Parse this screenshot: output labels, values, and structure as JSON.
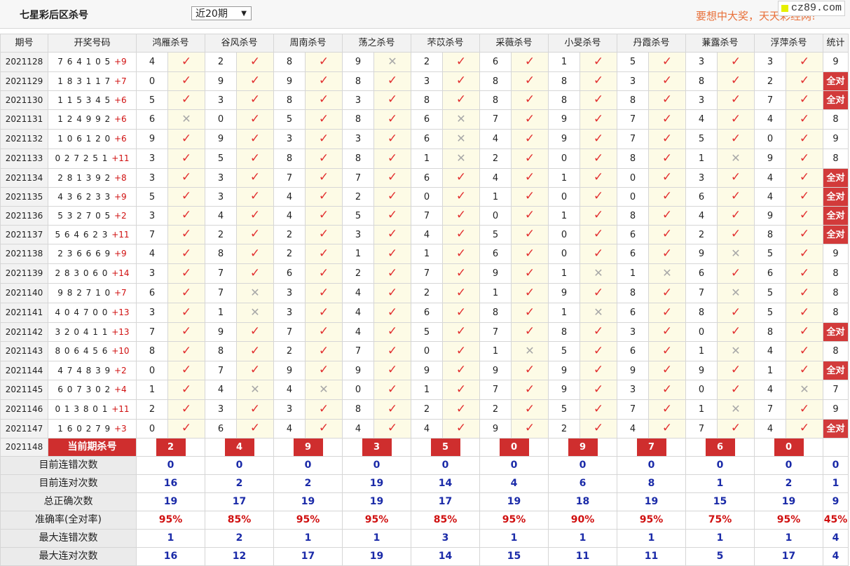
{
  "header": {
    "title": "七星彩后区杀号",
    "period_select": "近20期",
    "slogan": "要想中大奖，天天彩经网!",
    "site_badge": "cz89.com"
  },
  "columns": [
    "期号",
    "开奖号码",
    "鸿雁杀号",
    "谷风杀号",
    "周南杀号",
    "荡之杀号",
    "芣苡杀号",
    "采薇杀号",
    "小旻杀号",
    "丹霞杀号",
    "蒹露杀号",
    "浮萍杀号",
    "统计"
  ],
  "rows": [
    {
      "period": "2021128",
      "draw": "7 6 4 1 0 5",
      "bonus": "+9",
      "kills": [
        "4",
        "2",
        "8",
        "9",
        "2",
        "6",
        "1",
        "5",
        "3",
        "3"
      ],
      "marks": [
        1,
        1,
        1,
        0,
        1,
        1,
        1,
        1,
        1,
        1
      ],
      "stat": "9"
    },
    {
      "period": "2021129",
      "draw": "1 8 3 1 1 7",
      "bonus": "+7",
      "kills": [
        "0",
        "9",
        "9",
        "8",
        "3",
        "8",
        "8",
        "3",
        "8",
        "2"
      ],
      "marks": [
        1,
        1,
        1,
        1,
        1,
        1,
        1,
        1,
        1,
        1
      ],
      "stat": "全对"
    },
    {
      "period": "2021130",
      "draw": "1 1 5 3 4 5",
      "bonus": "+6",
      "kills": [
        "5",
        "3",
        "8",
        "3",
        "8",
        "8",
        "8",
        "8",
        "3",
        "7"
      ],
      "marks": [
        1,
        1,
        1,
        1,
        1,
        1,
        1,
        1,
        1,
        1
      ],
      "stat": "全对"
    },
    {
      "period": "2021131",
      "draw": "1 2 4 9 9 2",
      "bonus": "+6",
      "kills": [
        "6",
        "0",
        "5",
        "8",
        "6",
        "7",
        "9",
        "7",
        "4",
        "4"
      ],
      "marks": [
        0,
        1,
        1,
        1,
        0,
        1,
        1,
        1,
        1,
        1
      ],
      "stat": "8"
    },
    {
      "period": "2021132",
      "draw": "1 0 6 1 2 0",
      "bonus": "+6",
      "kills": [
        "9",
        "9",
        "3",
        "3",
        "6",
        "4",
        "9",
        "7",
        "5",
        "0"
      ],
      "marks": [
        1,
        1,
        1,
        1,
        0,
        1,
        1,
        1,
        1,
        1
      ],
      "stat": "9"
    },
    {
      "period": "2021133",
      "draw": "0 2 7 2 5 1",
      "bonus": "+11",
      "kills": [
        "3",
        "5",
        "8",
        "8",
        "1",
        "2",
        "0",
        "8",
        "1",
        "9"
      ],
      "marks": [
        1,
        1,
        1,
        1,
        0,
        1,
        1,
        1,
        0,
        1
      ],
      "stat": "8"
    },
    {
      "period": "2021134",
      "draw": "2 8 1 3 9 2",
      "bonus": "+8",
      "kills": [
        "3",
        "3",
        "7",
        "7",
        "6",
        "4",
        "1",
        "0",
        "3",
        "4"
      ],
      "marks": [
        1,
        1,
        1,
        1,
        1,
        1,
        1,
        1,
        1,
        1
      ],
      "stat": "全对"
    },
    {
      "period": "2021135",
      "draw": "4 3 6 2 3 3",
      "bonus": "+9",
      "kills": [
        "5",
        "3",
        "4",
        "2",
        "0",
        "1",
        "0",
        "0",
        "6",
        "4"
      ],
      "marks": [
        1,
        1,
        1,
        1,
        1,
        1,
        1,
        1,
        1,
        1
      ],
      "stat": "全对"
    },
    {
      "period": "2021136",
      "draw": "5 3 2 7 0 5",
      "bonus": "+2",
      "kills": [
        "3",
        "4",
        "4",
        "5",
        "7",
        "0",
        "1",
        "8",
        "4",
        "9"
      ],
      "marks": [
        1,
        1,
        1,
        1,
        1,
        1,
        1,
        1,
        1,
        1
      ],
      "stat": "全对"
    },
    {
      "period": "2021137",
      "draw": "5 6 4 6 2 3",
      "bonus": "+11",
      "kills": [
        "7",
        "2",
        "2",
        "3",
        "4",
        "5",
        "0",
        "6",
        "2",
        "8"
      ],
      "marks": [
        1,
        1,
        1,
        1,
        1,
        1,
        1,
        1,
        1,
        1
      ],
      "stat": "全对"
    },
    {
      "period": "2021138",
      "draw": "2 3 6 6 6 9",
      "bonus": "+9",
      "kills": [
        "4",
        "8",
        "2",
        "1",
        "1",
        "6",
        "0",
        "6",
        "9",
        "5"
      ],
      "marks": [
        1,
        1,
        1,
        1,
        1,
        1,
        1,
        1,
        0,
        1
      ],
      "stat": "9"
    },
    {
      "period": "2021139",
      "draw": "2 8 3 0 6 0",
      "bonus": "+14",
      "kills": [
        "3",
        "7",
        "6",
        "2",
        "7",
        "9",
        "1",
        "1",
        "6",
        "6"
      ],
      "marks": [
        1,
        1,
        1,
        1,
        1,
        1,
        0,
        0,
        1,
        1
      ],
      "stat": "8"
    },
    {
      "period": "2021140",
      "draw": "9 8 2 7 1 0",
      "bonus": "+7",
      "kills": [
        "6",
        "7",
        "3",
        "4",
        "2",
        "1",
        "9",
        "8",
        "7",
        "5"
      ],
      "marks": [
        1,
        0,
        1,
        1,
        1,
        1,
        1,
        1,
        0,
        1
      ],
      "stat": "8"
    },
    {
      "period": "2021141",
      "draw": "4 0 4 7 0 0",
      "bonus": "+13",
      "kills": [
        "3",
        "1",
        "3",
        "4",
        "6",
        "8",
        "1",
        "6",
        "8",
        "5"
      ],
      "marks": [
        1,
        0,
        1,
        1,
        1,
        1,
        0,
        1,
        1,
        1
      ],
      "stat": "8"
    },
    {
      "period": "2021142",
      "draw": "3 2 0 4 1 1",
      "bonus": "+13",
      "kills": [
        "7",
        "9",
        "7",
        "4",
        "5",
        "7",
        "8",
        "3",
        "0",
        "8"
      ],
      "marks": [
        1,
        1,
        1,
        1,
        1,
        1,
        1,
        1,
        1,
        1
      ],
      "stat": "全对"
    },
    {
      "period": "2021143",
      "draw": "8 0 6 4 5 6",
      "bonus": "+10",
      "kills": [
        "8",
        "8",
        "2",
        "7",
        "0",
        "1",
        "5",
        "6",
        "1",
        "4"
      ],
      "marks": [
        1,
        1,
        1,
        1,
        1,
        0,
        1,
        1,
        0,
        1
      ],
      "stat": "8"
    },
    {
      "period": "2021144",
      "draw": "4 7 4 8 3 9",
      "bonus": "+2",
      "kills": [
        "0",
        "7",
        "9",
        "9",
        "9",
        "9",
        "9",
        "9",
        "9",
        "1"
      ],
      "marks": [
        1,
        1,
        1,
        1,
        1,
        1,
        1,
        1,
        1,
        1
      ],
      "stat": "全对"
    },
    {
      "period": "2021145",
      "draw": "6 0 7 3 0 2",
      "bonus": "+4",
      "kills": [
        "1",
        "4",
        "4",
        "0",
        "1",
        "7",
        "9",
        "3",
        "0",
        "4"
      ],
      "marks": [
        1,
        0,
        0,
        1,
        1,
        1,
        1,
        1,
        1,
        0
      ],
      "stat": "7"
    },
    {
      "period": "2021146",
      "draw": "0 1 3 8 0 1",
      "bonus": "+11",
      "kills": [
        "2",
        "3",
        "3",
        "8",
        "2",
        "2",
        "5",
        "7",
        "1",
        "7"
      ],
      "marks": [
        1,
        1,
        1,
        1,
        1,
        1,
        1,
        1,
        0,
        1
      ],
      "stat": "9"
    },
    {
      "period": "2021147",
      "draw": "1 6 0 2 7 9",
      "bonus": "+3",
      "kills": [
        "0",
        "6",
        "4",
        "4",
        "4",
        "9",
        "2",
        "4",
        "7",
        "4"
      ],
      "marks": [
        1,
        1,
        1,
        1,
        1,
        1,
        1,
        1,
        1,
        1
      ],
      "stat": "全对"
    }
  ],
  "current": {
    "period": "2021148",
    "label": "当前期杀号",
    "kills": [
      "2",
      "4",
      "9",
      "3",
      "5",
      "0",
      "9",
      "7",
      "6",
      "0"
    ]
  },
  "summary": [
    {
      "label": "目前连错次数",
      "values": [
        "0",
        "0",
        "0",
        "0",
        "0",
        "0",
        "0",
        "0",
        "0",
        "0",
        "0"
      ]
    },
    {
      "label": "目前连对次数",
      "values": [
        "16",
        "2",
        "2",
        "19",
        "14",
        "4",
        "6",
        "8",
        "1",
        "2",
        "1"
      ]
    },
    {
      "label": "总正确次数",
      "values": [
        "19",
        "17",
        "19",
        "19",
        "17",
        "19",
        "18",
        "19",
        "15",
        "19",
        "9"
      ]
    },
    {
      "label": "准确率(全对率)",
      "values": [
        "95%",
        "85%",
        "95%",
        "95%",
        "85%",
        "95%",
        "90%",
        "95%",
        "75%",
        "95%",
        "45%"
      ],
      "rate": true
    },
    {
      "label": "最大连错次数",
      "values": [
        "1",
        "2",
        "1",
        "1",
        "3",
        "1",
        "1",
        "1",
        "1",
        "1",
        "4"
      ]
    },
    {
      "label": "最大连对次数",
      "values": [
        "16",
        "12",
        "17",
        "19",
        "14",
        "15",
        "11",
        "11",
        "5",
        "17",
        "4"
      ]
    }
  ],
  "icons": {
    "correct": "check-mark-icon",
    "wrong": "cross-mark-icon",
    "correct_color": "#e23030",
    "wrong_color": "#a8a8a8",
    "highlight_color": "#cf2e2e"
  }
}
